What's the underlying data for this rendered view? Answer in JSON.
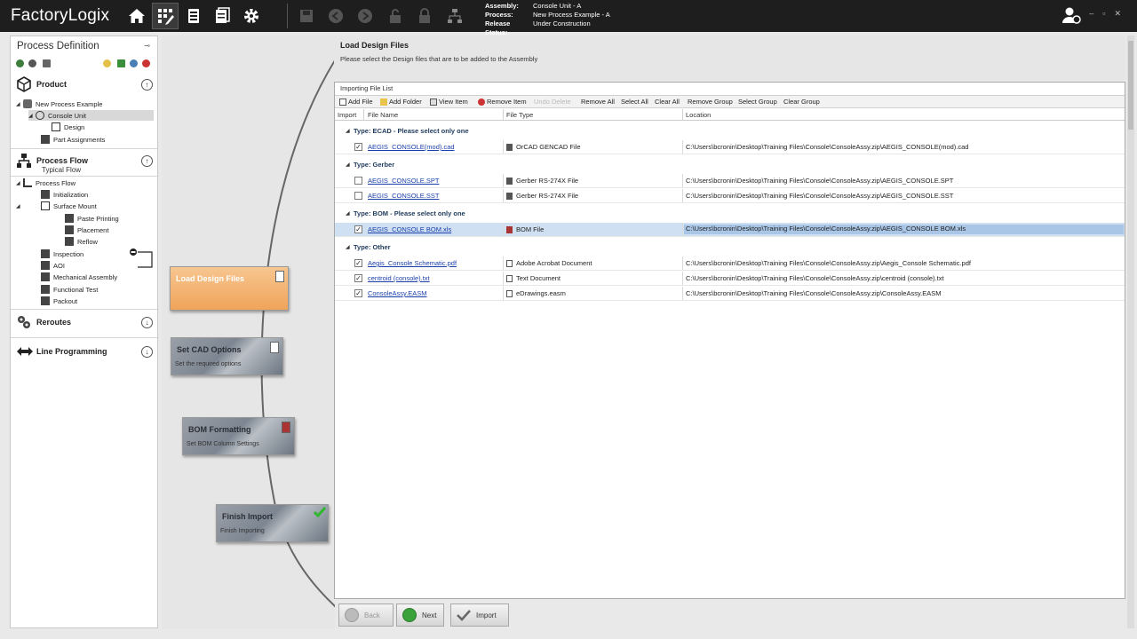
{
  "app": {
    "logo": "FactoryLogix"
  },
  "context": {
    "assembly_label": "Assembly:",
    "assembly_value": "Console Unit - A",
    "process_label": "Process:",
    "process_value": "New Process Example - A",
    "release_label": "Release Status:",
    "release_value": "Under Construction"
  },
  "window": {
    "min": "–",
    "max": "▫",
    "close": "✕"
  },
  "left": {
    "title": "Process Definition",
    "product_section": "Product",
    "product_tree": [
      {
        "label": "New Process Example"
      },
      {
        "label": "Console Unit"
      },
      {
        "label": "Design"
      },
      {
        "label": "Part Assignments"
      }
    ],
    "process_flow_section": "Process Flow",
    "process_flow_sub": "Typical Flow",
    "flow_tree": [
      {
        "label": "Process Flow"
      },
      {
        "label": "Initialization"
      },
      {
        "label": "Surface Mount"
      },
      {
        "label": "Paste Printing"
      },
      {
        "label": "Placement"
      },
      {
        "label": "Reflow"
      },
      {
        "label": "Inspection"
      },
      {
        "label": "AOI"
      },
      {
        "label": "Mechanical Assembly"
      },
      {
        "label": "Functional Test"
      },
      {
        "label": "Packout"
      }
    ],
    "reroutes_section": "Reroutes",
    "line_programming_section": "Line Programming"
  },
  "flow_steps": [
    {
      "title": "Load Design Files",
      "sub": ""
    },
    {
      "title": "Set CAD Options",
      "sub": "Set the required options"
    },
    {
      "title": "BOM Formatting",
      "sub": "Set BOM Column Settings"
    },
    {
      "title": "Finish Import",
      "sub": "Finish Importing"
    }
  ],
  "main": {
    "title": "Load Design Files",
    "subtitle": "Please select the Design files that are to be added to the Assembly",
    "list_title": "Importing File List",
    "toolbar": {
      "add_file": "Add File",
      "add_folder": "Add Folder",
      "view_item": "View Item",
      "remove_item": "Remove Item",
      "undo_delete": "Undo Delete",
      "remove_all": "Remove All",
      "select_all": "Select All",
      "clear_all": "Clear All",
      "remove_group": "Remove Group",
      "select_group": "Select Group",
      "clear_group": "Clear Group"
    },
    "columns": {
      "import": "Import",
      "file_name": "File Name",
      "file_type": "File Type",
      "location": "Location"
    },
    "groups": [
      {
        "label": "Type: ECAD - Please select only one"
      },
      {
        "label": "Type: Gerber"
      },
      {
        "label": "Type: BOM - Please select only one"
      },
      {
        "label": "Type: Other"
      }
    ],
    "files": [
      {
        "checked": "✓",
        "name": "AEGIS_CONSOLE(mod).cad",
        "type": "OrCAD GENCAD File",
        "location": "C:\\Users\\bcronin\\Desktop\\Training Files\\Console\\ConsoleAssy.zip\\AEGIS_CONSOLE(mod).cad"
      },
      {
        "checked": "",
        "name": "AEGIS_CONSOLE.SPT",
        "type": "Gerber RS-274X File",
        "location": "C:\\Users\\bcronin\\Desktop\\Training Files\\Console\\ConsoleAssy.zip\\AEGIS_CONSOLE.SPT"
      },
      {
        "checked": "",
        "name": "AEGIS_CONSOLE.SST",
        "type": "Gerber RS-274X File",
        "location": "C:\\Users\\bcronin\\Desktop\\Training Files\\Console\\ConsoleAssy.zip\\AEGIS_CONSOLE.SST"
      },
      {
        "checked": "✓",
        "name": "AEGIS_CONSOLE BOM.xls",
        "type": "BOM File",
        "location": "C:\\Users\\bcronin\\Desktop\\Training Files\\Console\\ConsoleAssy.zip\\AEGIS_CONSOLE BOM.xls"
      },
      {
        "checked": "✓",
        "name": "Aegis_Console Schematic.pdf",
        "type": "Adobe Acrobat Document",
        "location": "C:\\Users\\bcronin\\Desktop\\Training Files\\Console\\ConsoleAssy.zip\\Aegis_Console Schematic.pdf"
      },
      {
        "checked": "✓",
        "name": "centroid (console).txt",
        "type": "Text Document",
        "location": "C:\\Users\\bcronin\\Desktop\\Training Files\\Console\\ConsoleAssy.zip\\centroid (console).txt"
      },
      {
        "checked": "✓",
        "name": "ConsoleAssy.EASM",
        "type": "eDrawings.easm",
        "location": "C:\\Users\\bcronin\\Desktop\\Training Files\\Console\\ConsoleAssy.zip\\ConsoleAssy.EASM"
      }
    ]
  },
  "bottom": {
    "back": "Back",
    "next": "Next",
    "import": "Import"
  },
  "colors": {
    "topbar": "#1e1e1e",
    "active_step": "#f0a45a",
    "highlight_row": "#cfe0f2",
    "link": "#1a3faa"
  }
}
